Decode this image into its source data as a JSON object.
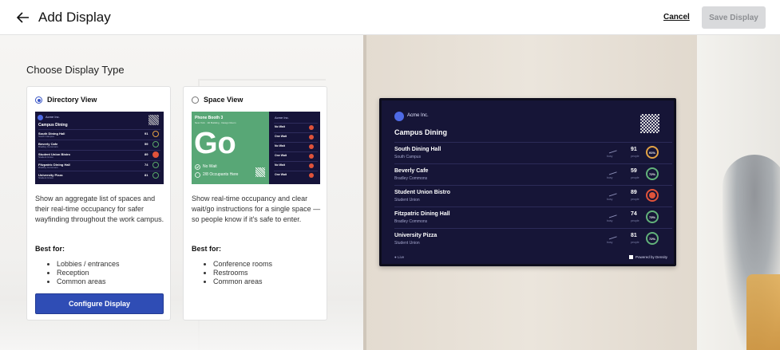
{
  "header": {
    "title": "Add Display",
    "cancel_label": "Cancel",
    "save_label": "Save Display"
  },
  "main": {
    "section_title": "Choose Display Type",
    "cards": [
      {
        "label": "Directory View",
        "selected": true,
        "description": "Show an aggregate list of spaces and their real-time occupancy for safer wayfinding throughout the work campus.",
        "best_for_label": "Best for:",
        "best_for": [
          "Lobbies / entrances",
          "Reception",
          "Common areas"
        ],
        "button_label": "Configure Display"
      },
      {
        "label": "Space View",
        "selected": false,
        "description": "Show real-time occupancy and clear wait/go instructions for a single space — so people know if it's safe to enter.",
        "best_for_label": "Best for:",
        "best_for": [
          "Conference rooms",
          "Restrooms",
          "Common areas"
        ]
      }
    ],
    "directory_thumb": {
      "org": "Acme Inc.",
      "title": "Campus Dining",
      "rows": [
        {
          "name": "South Dining Hall",
          "sub": "South Campus",
          "value": "91"
        },
        {
          "name": "Beverly Cafe",
          "sub": "Bradley Commons",
          "value": "59"
        },
        {
          "name": "Student Union Bistro",
          "sub": "Student Union",
          "value": "89"
        },
        {
          "name": "Fitzpatric Dining Hall",
          "sub": "Bradley Commons",
          "value": "74"
        },
        {
          "name": "University Pizza",
          "sub": "Student Union",
          "value": "81"
        }
      ]
    },
    "space_thumb": {
      "name": "Phone Booth 3",
      "sub": "New York · 1D Building · Design Room",
      "status": "Go",
      "wait": "No Wait",
      "occupants": "2/8 Occupants Here",
      "side_org": "Acme Inc.",
      "side_rows": [
        "No Wait",
        "One Wait",
        "No Wait",
        "One Wait",
        "No Wait",
        "One Wait"
      ]
    }
  },
  "display": {
    "org": "Acme Inc.",
    "title": "Campus Dining",
    "people_label": "people",
    "trend_label": "busy",
    "rows": [
      {
        "name": "South Dining Hall",
        "sub": "South Campus",
        "value": "91",
        "pct": "91%",
        "ring_color": "#e2a245"
      },
      {
        "name": "Beverly Cafe",
        "sub": "Bradley Commons",
        "value": "59",
        "pct": "72%",
        "ring_color": "#62b27a"
      },
      {
        "name": "Student Union Bistro",
        "sub": "Student Union",
        "value": "89",
        "pct": "",
        "ring_color": "#e0533a"
      },
      {
        "name": "Fitzpatric Dining Hall",
        "sub": "Bradley Commons",
        "value": "74",
        "pct": "73%",
        "ring_color": "#62b27a"
      },
      {
        "name": "University Pizza",
        "sub": "Student Union",
        "value": "81",
        "pct": "72%",
        "ring_color": "#62b27a"
      }
    ],
    "live_label": "Live",
    "powered_label": "Powered by Density"
  },
  "colors": {
    "primary_button": "#2f4db5",
    "display_bg": "#161537"
  }
}
